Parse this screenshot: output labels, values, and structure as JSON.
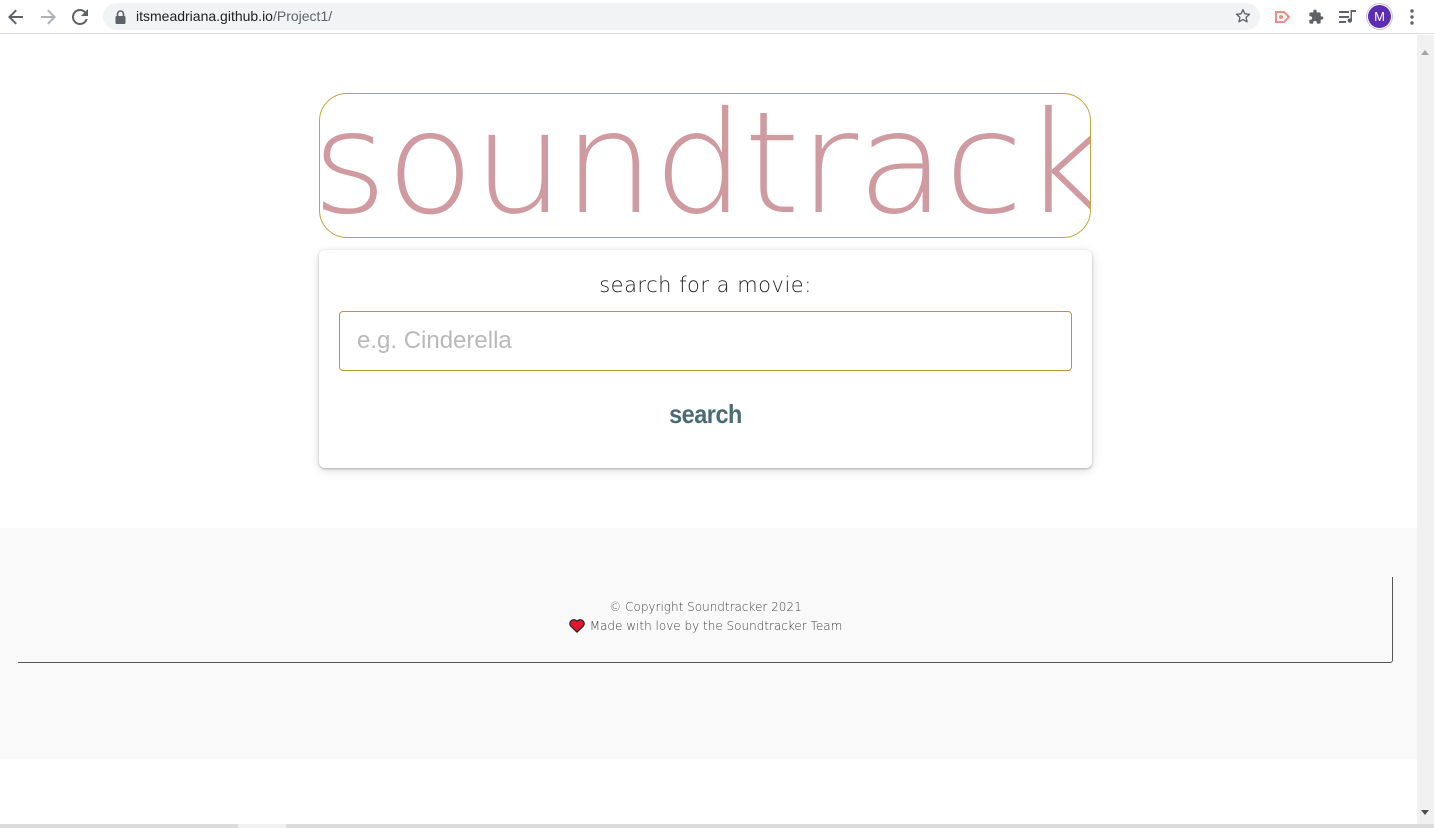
{
  "browser": {
    "url_host": "itsmeadriana.github.io",
    "url_path": "/Project1/",
    "profile_initial": "M",
    "icons": [
      "back-icon",
      "forward-icon",
      "reload-icon",
      "lock-icon",
      "star-icon",
      "screencast-extension-icon",
      "extensions-puzzle-icon",
      "media-queue-icon",
      "kebab-menu-icon"
    ]
  },
  "hero": {
    "title": "soundtracker"
  },
  "search": {
    "label": "search for a movie:",
    "placeholder": "e.g. Cinderella",
    "value": "",
    "button_label": "search"
  },
  "footer": {
    "copyright": "© Copyright Soundtracker 2021",
    "made_with": "Made with love by the Soundtracker Team"
  },
  "colors": {
    "title_pink": "#cf9aa0",
    "gold_border": "#c6a43c",
    "button_teal": "#4a6b73",
    "heart_red": "#e0182d"
  }
}
